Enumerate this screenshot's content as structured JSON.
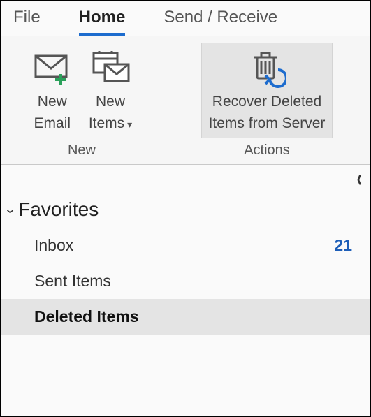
{
  "menu": {
    "file": "File",
    "home": "Home",
    "sendreceive": "Send / Receive",
    "active": "home"
  },
  "ribbon": {
    "new": {
      "email_label_line1": "New",
      "email_label_line2": "Email",
      "items_label_line1": "New",
      "items_label_line2": "Items",
      "group_label": "New"
    },
    "actions": {
      "recover_line1": "Recover Deleted",
      "recover_line2": "Items from Server",
      "group_label": "Actions"
    }
  },
  "nav": {
    "favorites_label": "Favorites",
    "items": [
      {
        "label": "Inbox",
        "count": "21",
        "selected": false
      },
      {
        "label": "Sent Items",
        "count": "",
        "selected": false
      },
      {
        "label": "Deleted Items",
        "count": "",
        "selected": true
      }
    ]
  }
}
